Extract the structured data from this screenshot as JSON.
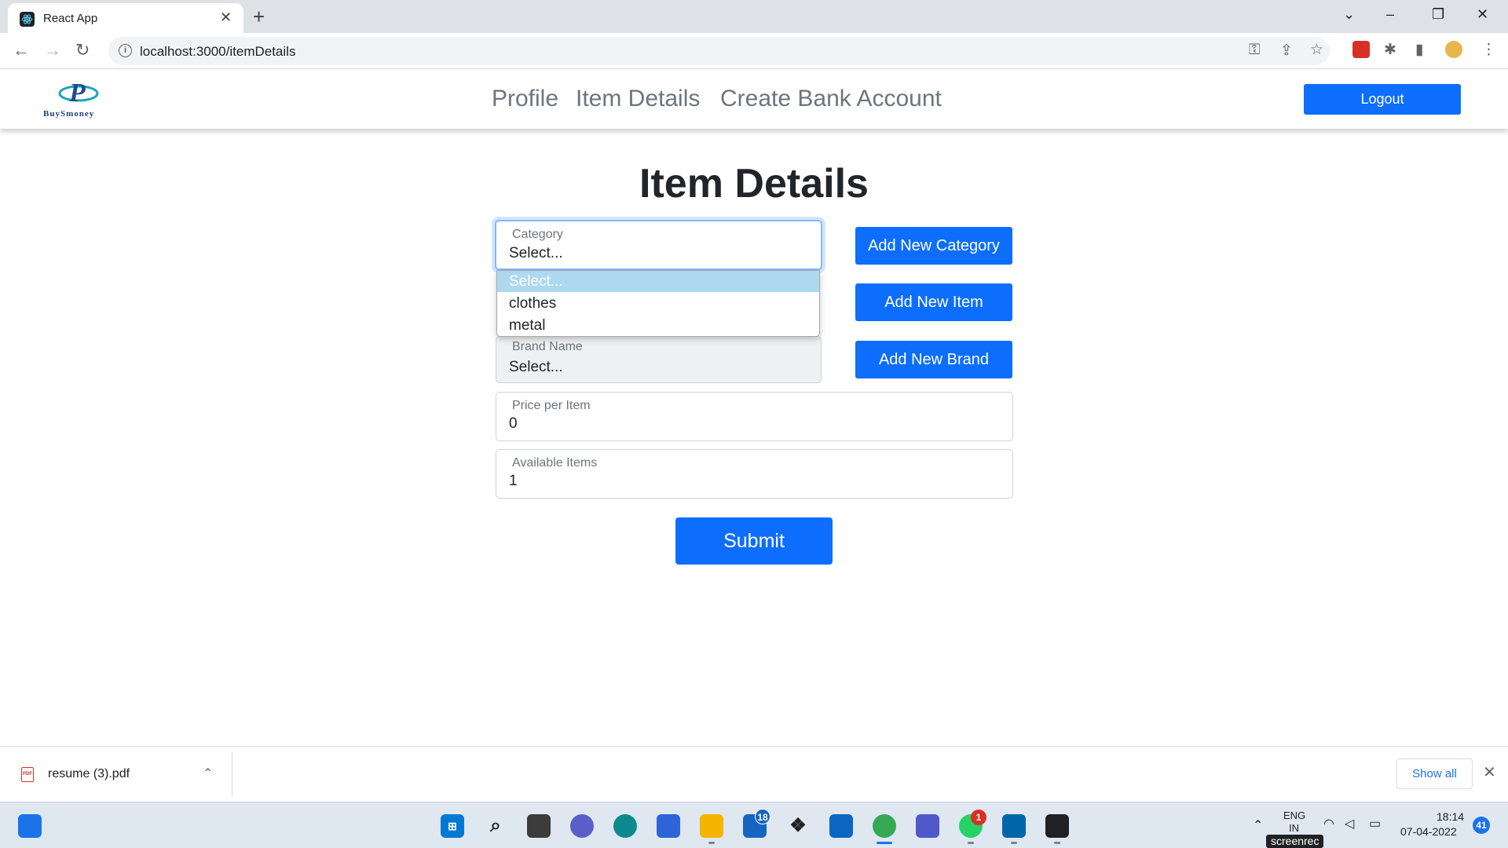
{
  "browser": {
    "tab_title": "React App",
    "url": "localhost:3000/itemDetails",
    "new_tab_symbol": "+",
    "close_symbol": "✕"
  },
  "app": {
    "brand_text": "BuySmoney",
    "nav": [
      "Profile",
      "Item Details",
      "Create Bank Account"
    ],
    "logout_label": "Logout"
  },
  "form": {
    "title": "Item Details",
    "category": {
      "label": "Category",
      "value": "Select..."
    },
    "category_options": [
      "Select...",
      "clothes",
      "metal"
    ],
    "brand": {
      "label": "Brand Name",
      "value": "Select..."
    },
    "price": {
      "label": "Price per Item",
      "value": "0"
    },
    "available": {
      "label": "Available Items",
      "value": "1"
    },
    "add_category_label": "Add New Category",
    "add_item_label": "Add New Item",
    "add_brand_label": "Add New Brand",
    "submit_label": "Submit"
  },
  "download": {
    "filename": "resume (3).pdf",
    "show_all": "Show all",
    "pdf_tag": "PDF"
  },
  "taskbar": {
    "mail_badge": "18",
    "whatsapp_badge": "1",
    "lang_line1": "ENG",
    "lang_line2": "IN",
    "time": "18:14",
    "date": "07-04-2022",
    "notif_count": "41",
    "watermark": "screenrec"
  },
  "colors": {
    "primary": "#0d6efd",
    "focus_ring": "#86b7fe",
    "option_highlight": "#add8f0",
    "nav_link": "#6c757d"
  }
}
